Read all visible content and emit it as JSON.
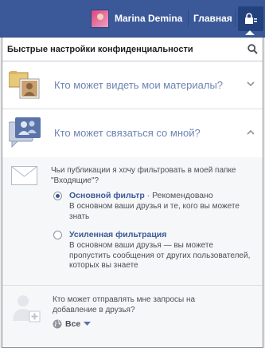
{
  "topbar": {
    "user_name": "Marina Demina",
    "home_label": "Главная"
  },
  "panel": {
    "title": "Быстрые настройки конфиденциальности",
    "sections": [
      {
        "label": "Кто может видеть мои материалы?",
        "icon": "photo-profile-icon",
        "expanded": false
      },
      {
        "label": "Кто может связаться со мной?",
        "icon": "people-chat-icon",
        "expanded": true
      }
    ],
    "filter": {
      "question": "Чьи публикации я хочу фильтровать в моей папке \"Входящие\"?",
      "options": [
        {
          "title": "Основной фильтр",
          "recommended": " · Рекомендовано",
          "desc": "В основном ваши друзья и те, кого вы можете знать",
          "selected": true
        },
        {
          "title": "Усиленная фильтрация",
          "recommended": "",
          "desc": "В основном ваши друзья — вы можете пропустить сообщения от других пользователей, которых вы знаете",
          "selected": false
        }
      ]
    },
    "friend_requests": {
      "question": "Кто может отправлять мне запросы на добавление в друзья?",
      "value": "Все"
    }
  },
  "colors": {
    "brand": "#3b5998",
    "link": "#6d84b4"
  }
}
